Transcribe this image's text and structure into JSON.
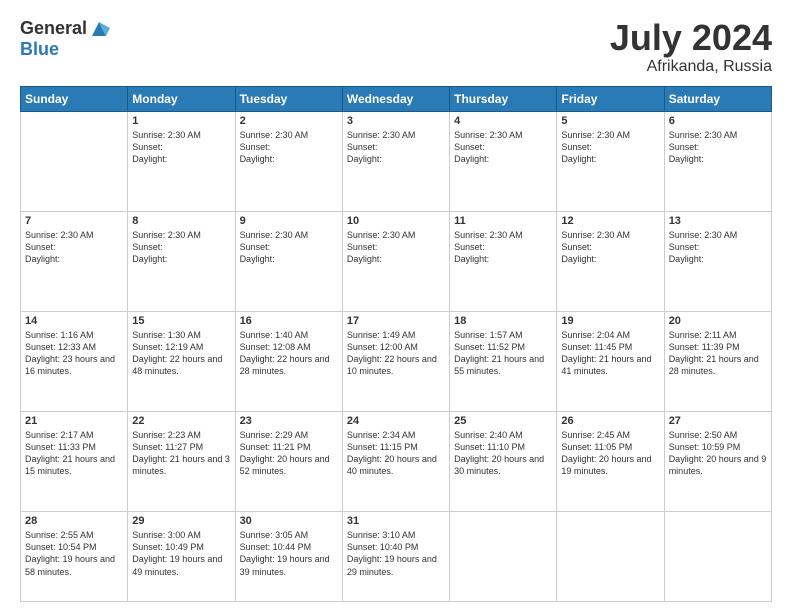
{
  "header": {
    "logo_line1": "General",
    "logo_line2": "Blue",
    "title": "July 2024",
    "location": "Afrikanda, Russia"
  },
  "weekdays": [
    "Sunday",
    "Monday",
    "Tuesday",
    "Wednesday",
    "Thursday",
    "Friday",
    "Saturday"
  ],
  "weeks": [
    [
      {
        "day": "",
        "info": ""
      },
      {
        "day": "1",
        "info": "Sunrise: 2:30 AM\nSunset: \nDaylight: "
      },
      {
        "day": "2",
        "info": "Sunrise: 2:30 AM\nSunset: \nDaylight: "
      },
      {
        "day": "3",
        "info": "Sunrise: 2:30 AM\nSunset: \nDaylight: "
      },
      {
        "day": "4",
        "info": "Sunrise: 2:30 AM\nSunset: \nDaylight: "
      },
      {
        "day": "5",
        "info": "Sunrise: 2:30 AM\nSunset: \nDaylight: "
      },
      {
        "day": "6",
        "info": "Sunrise: 2:30 AM\nSunset: \nDaylight: "
      }
    ],
    [
      {
        "day": "7",
        "info": "Sunrise: 2:30 AM\nSunset: \nDaylight: "
      },
      {
        "day": "8",
        "info": "Sunrise: 2:30 AM\nSunset: \nDaylight: "
      },
      {
        "day": "9",
        "info": "Sunrise: 2:30 AM\nSunset: \nDaylight: "
      },
      {
        "day": "10",
        "info": "Sunrise: 2:30 AM\nSunset: \nDaylight: "
      },
      {
        "day": "11",
        "info": "Sunrise: 2:30 AM\nSunset: \nDaylight: "
      },
      {
        "day": "12",
        "info": "Sunrise: 2:30 AM\nSunset: \nDaylight: "
      },
      {
        "day": "13",
        "info": "Sunrise: 2:30 AM\nSunset: \nDaylight: "
      }
    ],
    [
      {
        "day": "14",
        "info": "Sunrise: 1:16 AM\nSunset: 12:33 AM\nDaylight: 23 hours and 16 minutes."
      },
      {
        "day": "15",
        "info": "Sunrise: 1:30 AM\nSunset: 12:19 AM\nDaylight: 22 hours and 48 minutes."
      },
      {
        "day": "16",
        "info": "Sunrise: 1:40 AM\nSunset: 12:08 AM\nDaylight: 22 hours and 28 minutes."
      },
      {
        "day": "17",
        "info": "Sunrise: 1:49 AM\nSunset: 12:00 AM\nDaylight: 22 hours and 10 minutes."
      },
      {
        "day": "18",
        "info": "Sunrise: 1:57 AM\nSunset: 11:52 PM\nDaylight: 21 hours and 55 minutes."
      },
      {
        "day": "19",
        "info": "Sunrise: 2:04 AM\nSunset: 11:45 PM\nDaylight: 21 hours and 41 minutes."
      },
      {
        "day": "20",
        "info": "Sunrise: 2:11 AM\nSunset: 11:39 PM\nDaylight: 21 hours and 28 minutes."
      }
    ],
    [
      {
        "day": "21",
        "info": "Sunrise: 2:17 AM\nSunset: 11:33 PM\nDaylight: 21 hours and 15 minutes."
      },
      {
        "day": "22",
        "info": "Sunrise: 2:23 AM\nSunset: 11:27 PM\nDaylight: 21 hours and 3 minutes."
      },
      {
        "day": "23",
        "info": "Sunrise: 2:29 AM\nSunset: 11:21 PM\nDaylight: 20 hours and 52 minutes."
      },
      {
        "day": "24",
        "info": "Sunrise: 2:34 AM\nSunset: 11:15 PM\nDaylight: 20 hours and 40 minutes."
      },
      {
        "day": "25",
        "info": "Sunrise: 2:40 AM\nSunset: 11:10 PM\nDaylight: 20 hours and 30 minutes."
      },
      {
        "day": "26",
        "info": "Sunrise: 2:45 AM\nSunset: 11:05 PM\nDaylight: 20 hours and 19 minutes."
      },
      {
        "day": "27",
        "info": "Sunrise: 2:50 AM\nSunset: 10:59 PM\nDaylight: 20 hours and 9 minutes."
      }
    ],
    [
      {
        "day": "28",
        "info": "Sunrise: 2:55 AM\nSunset: 10:54 PM\nDaylight: 19 hours and 58 minutes."
      },
      {
        "day": "29",
        "info": "Sunrise: 3:00 AM\nSunset: 10:49 PM\nDaylight: 19 hours and 49 minutes."
      },
      {
        "day": "30",
        "info": "Sunrise: 3:05 AM\nSunset: 10:44 PM\nDaylight: 19 hours and 39 minutes."
      },
      {
        "day": "31",
        "info": "Sunrise: 3:10 AM\nSunset: 10:40 PM\nDaylight: 19 hours and 29 minutes."
      },
      {
        "day": "",
        "info": ""
      },
      {
        "day": "",
        "info": ""
      },
      {
        "day": "",
        "info": ""
      }
    ]
  ]
}
